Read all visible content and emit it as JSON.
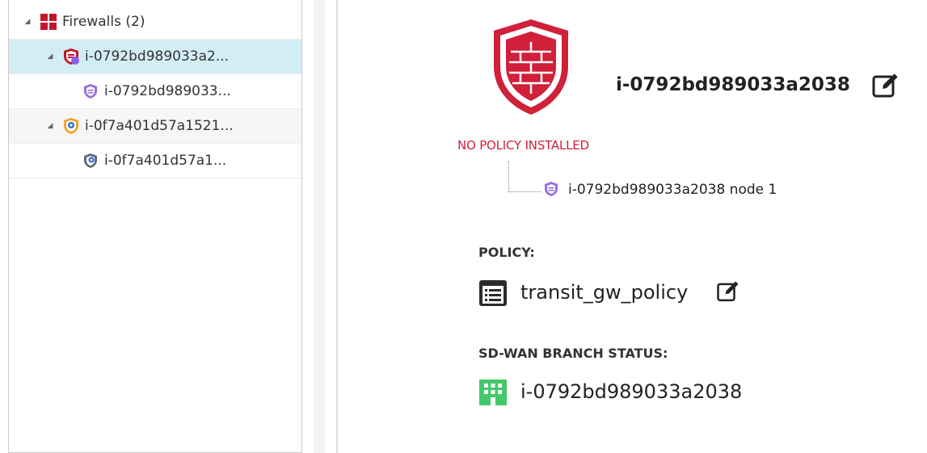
{
  "tree": {
    "root": {
      "label": "Firewalls (2)",
      "icon": "firewall-grid-icon"
    },
    "gateways": [
      {
        "label": "i-0792bd989033a2...",
        "icon": "shield-firewall-icon",
        "state": "selected",
        "children": [
          {
            "label": "i-0792bd989033...",
            "icon": "cluster-member-icon"
          }
        ]
      },
      {
        "label": "i-0f7a401d57a1521...",
        "icon": "shield-gateway-icon",
        "children": [
          {
            "label": "i-0f7a401d57a1...",
            "icon": "gateway-node-icon"
          }
        ]
      }
    ]
  },
  "details": {
    "gateway_name": "i-0792bd989033a2038",
    "status_text": "NO POLICY INSTALLED",
    "node_label": "i-0792bd989033a2038 node 1",
    "policy_heading": "POLICY:",
    "policy_name": "transit_gw_policy",
    "sdwan_heading": "SD-WAN BRANCH STATUS:",
    "sdwan_branch": "i-0792bd989033a2038"
  },
  "colors": {
    "accent_red": "#d0203a",
    "selected_row": "#d3edf5",
    "purple_icon": "#9b6ee0",
    "orange_icon": "#f2a530",
    "blue_icon": "#2d6fcf",
    "branch_green": "#43c96b"
  }
}
